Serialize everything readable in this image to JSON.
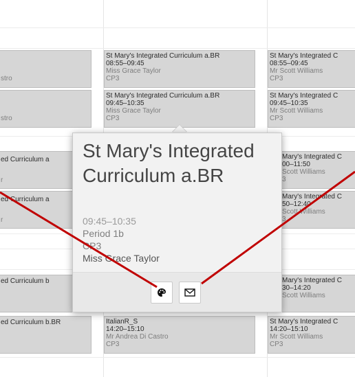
{
  "columns": {
    "left": [
      {
        "title": "",
        "time": "",
        "teacher": "stro",
        "room": ""
      },
      {
        "title": "",
        "time": "",
        "teacher": "stro",
        "room": ""
      },
      {
        "title": "ed Curriculum a",
        "time": "",
        "teacher": "r",
        "room": ""
      },
      {
        "title": "ed Curriculum a",
        "time": "",
        "teacher": "r",
        "room": ""
      },
      {
        "title": "ed Curriculum b",
        "time": "",
        "teacher": "",
        "room": ""
      },
      {
        "title": "ed Curriculum b.BR",
        "time": "",
        "teacher": "",
        "room": ""
      }
    ],
    "middle": [
      {
        "title": "St Mary's Integrated Curriculum a.BR",
        "time": "08:55–09:45",
        "teacher": "Miss Grace Taylor",
        "room": "CP3"
      },
      {
        "title": "St Mary's Integrated Curriculum a.BR",
        "time": "09:45–10:35",
        "teacher": "Miss Grace Taylor",
        "room": "CP3"
      },
      {
        "title": "ItalianR_S",
        "time": "14:20–15:10",
        "teacher": "Mr Andrea Di Castro",
        "room": "CP3"
      }
    ],
    "right": [
      {
        "title": "St Mary's Integrated C",
        "time": "08:55–09:45",
        "teacher": "Mr Scott Williams",
        "room": "CP3"
      },
      {
        "title": "St Mary's Integrated C",
        "time": "09:45–10:35",
        "teacher": "Mr Scott Williams",
        "room": "CP3"
      },
      {
        "title": "Mary's Integrated C",
        "time": "00–11:50",
        "teacher": "Scott Williams",
        "room": "3"
      },
      {
        "title": "Mary's Integrated C",
        "time": "50–12:40",
        "teacher": "Scott Williams",
        "room": "3"
      },
      {
        "title": "Mary's Integrated C",
        "time": "30–14:20",
        "teacher": "Scott Williams",
        "room": "3"
      },
      {
        "title": "St Mary's Integrated C",
        "time": "14:20–15:10",
        "teacher": "Mr Scott Williams",
        "room": "CP3"
      }
    ]
  },
  "popover": {
    "title": "St Mary's Integrated Curriculum a.BR",
    "time": "09:45–10:35",
    "period": "Period 1b",
    "room": "CP3",
    "teacher": "Miss Grace Taylor",
    "buttons": [
      {
        "icon": "palette-icon"
      },
      {
        "icon": "envelope-icon"
      }
    ]
  },
  "colors": {
    "card_bg": "#d6d6d6",
    "annotation_line": "#c00000"
  }
}
